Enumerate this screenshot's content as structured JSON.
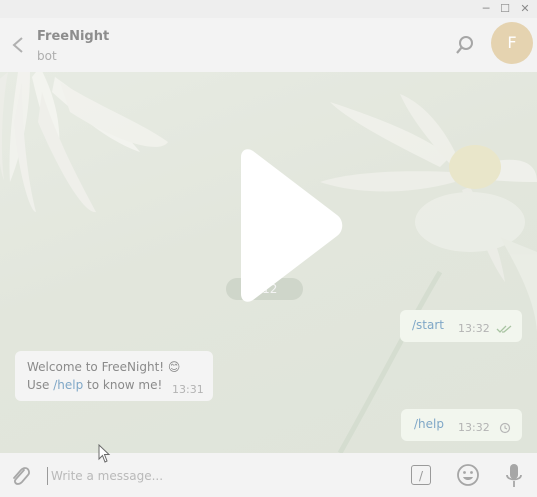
{
  "window": {
    "minimize": "─",
    "maximize": "☐",
    "close": "✕"
  },
  "header": {
    "title": "FreeNight",
    "subtitle": "bot",
    "avatar_letter": "F"
  },
  "chat": {
    "date_chip": "il 12",
    "messages": [
      {
        "direction": "out",
        "text": "/start",
        "time": "13:32",
        "status": "read"
      },
      {
        "direction": "in",
        "line1": "Welcome to FreeNight! 😊",
        "line2_prefix": "Use ",
        "line2_command": "/help",
        "line2_suffix": " to know me!",
        "time": "13:31"
      },
      {
        "direction": "out",
        "text": "/help",
        "time": "13:32",
        "status": "sending"
      }
    ]
  },
  "input": {
    "placeholder": "Write a message...",
    "value": "",
    "command_glyph": "/"
  },
  "icons": {
    "back": "back-arrow-icon",
    "search": "search-icon",
    "attach": "paperclip-icon",
    "emoji": "emoji-icon",
    "mic": "microphone-icon",
    "play": "play-icon"
  },
  "colors": {
    "header_bg": "#f3f3f3",
    "chat_bg": "#e3e7df",
    "command_link": "#7fa7c7",
    "avatar_bg": "#e5d3b0"
  }
}
